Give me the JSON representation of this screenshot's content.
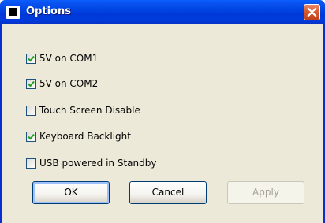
{
  "window": {
    "title": "Options",
    "icons": {
      "app": "window-icon",
      "close": "close-x-icon"
    }
  },
  "options": [
    {
      "label": "5V on COM1",
      "checked": true
    },
    {
      "label": "5V on COM2",
      "checked": true
    },
    {
      "label": "Touch Screen Disable",
      "checked": false
    },
    {
      "label": "Keyboard Backlight",
      "checked": true
    },
    {
      "label": "USB powered in Standby",
      "checked": false
    }
  ],
  "buttons": {
    "ok": "OK",
    "cancel": "Cancel",
    "apply": "Apply",
    "apply_enabled": false
  },
  "colors": {
    "titlebar": "#0042e0",
    "close": "#d95a2b",
    "dialog_bg": "#ece9d8",
    "checkmark": "#21a121"
  }
}
